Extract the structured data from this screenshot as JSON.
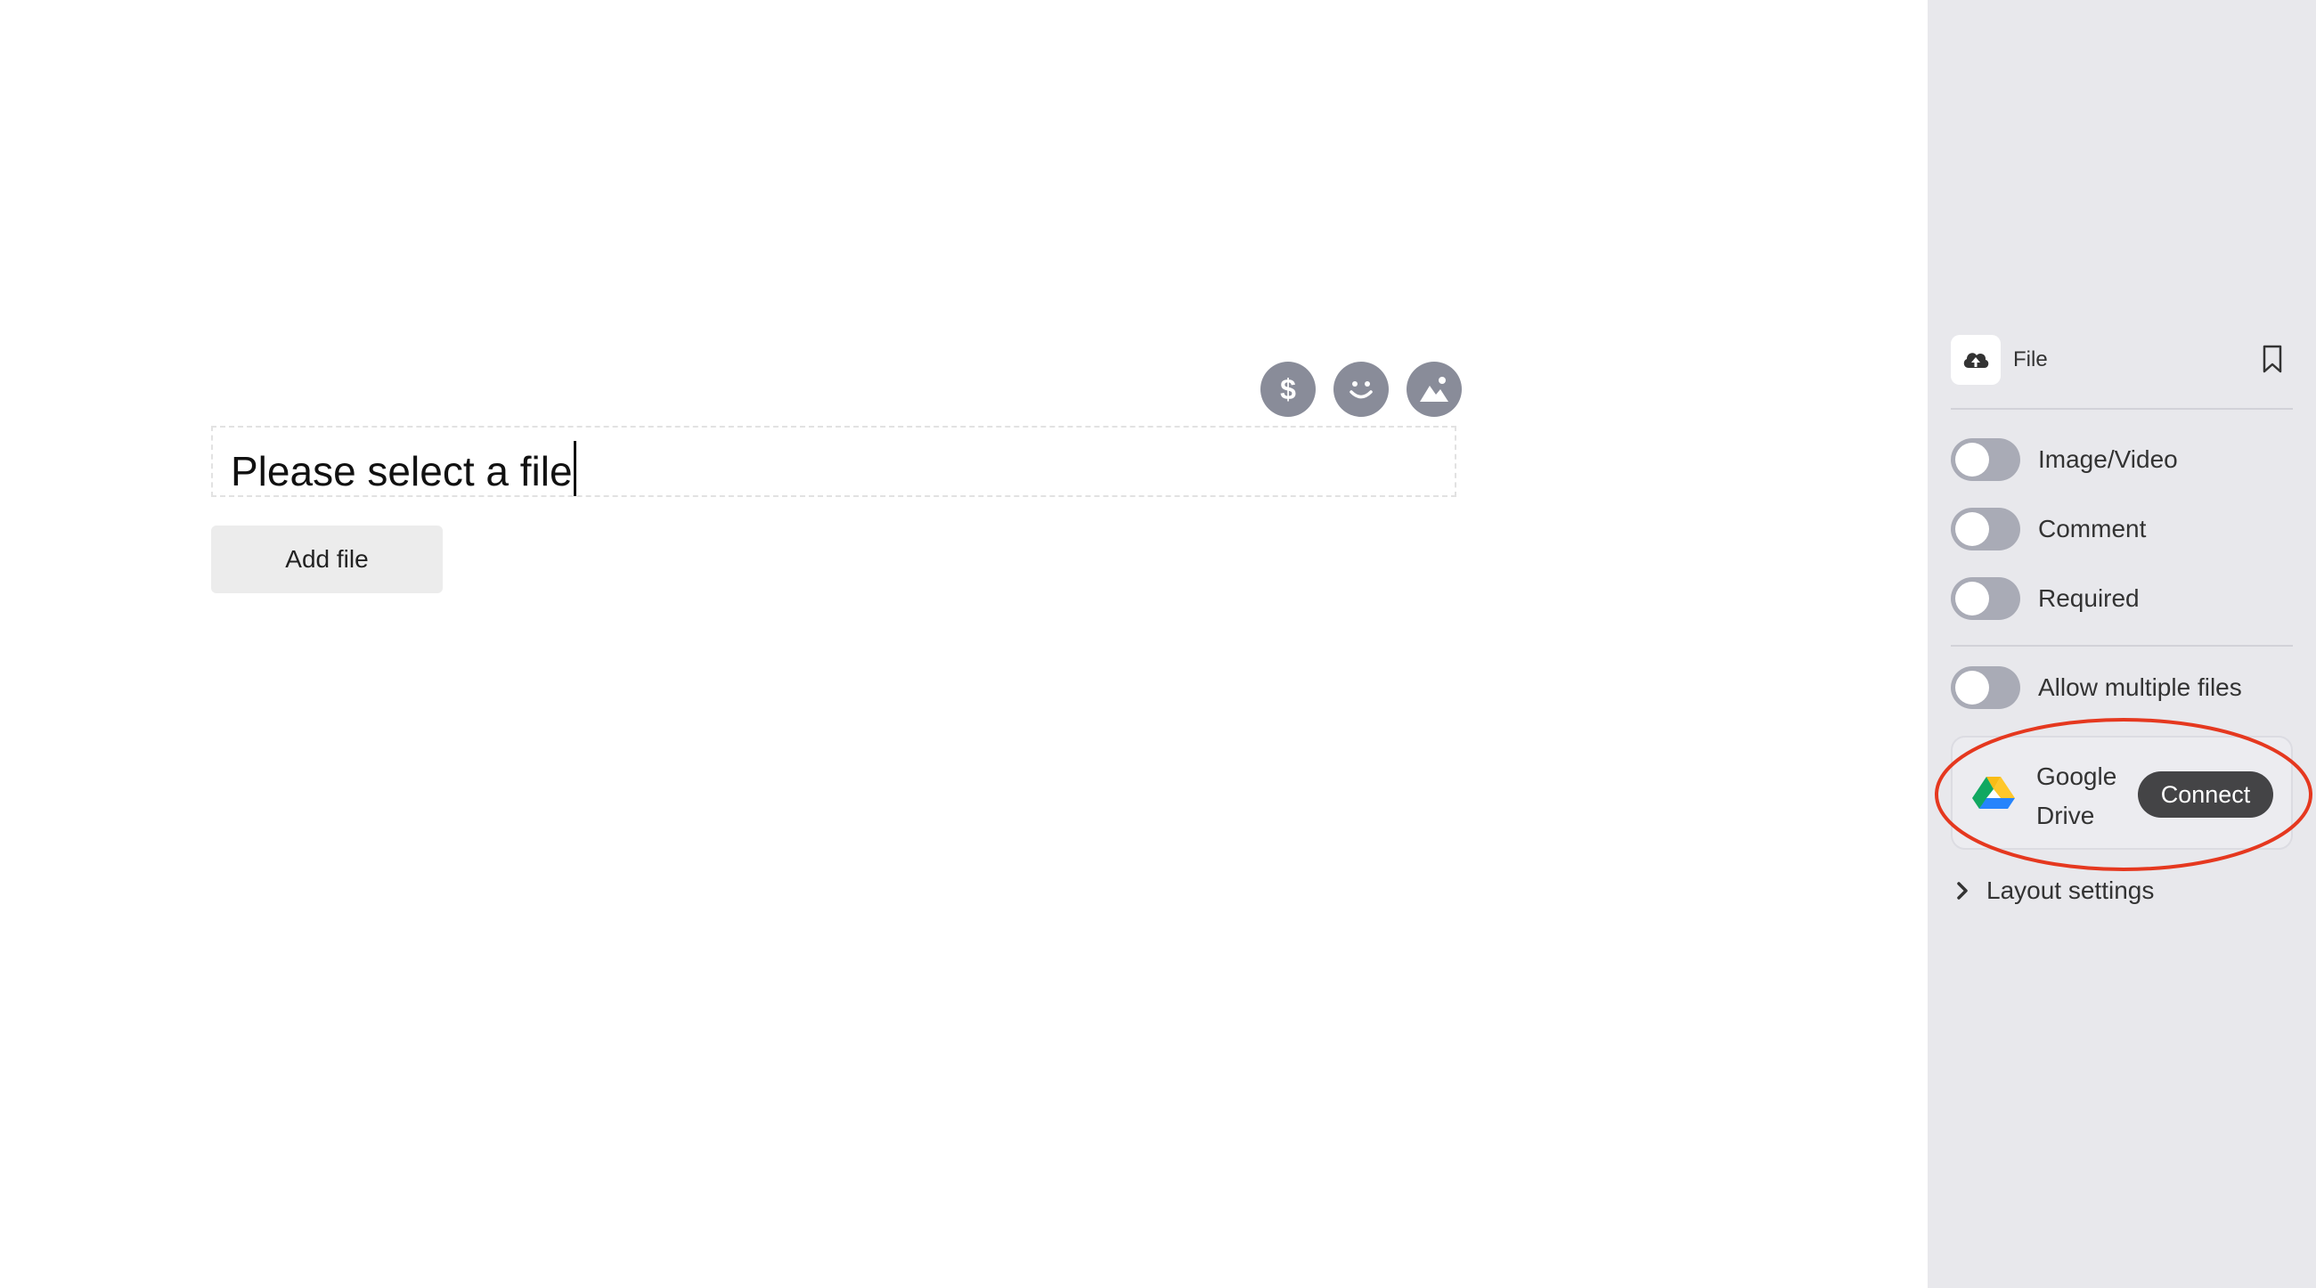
{
  "editor": {
    "question_text": "Please select a file",
    "add_file_label": "Add file",
    "toolbar": [
      {
        "name": "dollar-button",
        "icon": "dollar-icon"
      },
      {
        "name": "emoji-button",
        "icon": "smiley-icon"
      },
      {
        "name": "image-button",
        "icon": "image-icon"
      }
    ]
  },
  "panel": {
    "field_type_label": "File",
    "toggles": [
      {
        "label": "Image/Video",
        "on": false
      },
      {
        "label": "Comment",
        "on": false
      },
      {
        "label": "Required",
        "on": false
      },
      {
        "label": "Allow multiple files",
        "on": false
      }
    ],
    "integration": {
      "name": "Google Drive",
      "connect_label": "Connect"
    },
    "layout_settings_label": "Layout settings"
  },
  "colors": {
    "panel_bg": "#e8e8ec",
    "toolbar_icon_bg": "#898c99",
    "toggle_off": "#a9abb6",
    "connect_button": "#444446",
    "highlight": "#e5381f"
  }
}
